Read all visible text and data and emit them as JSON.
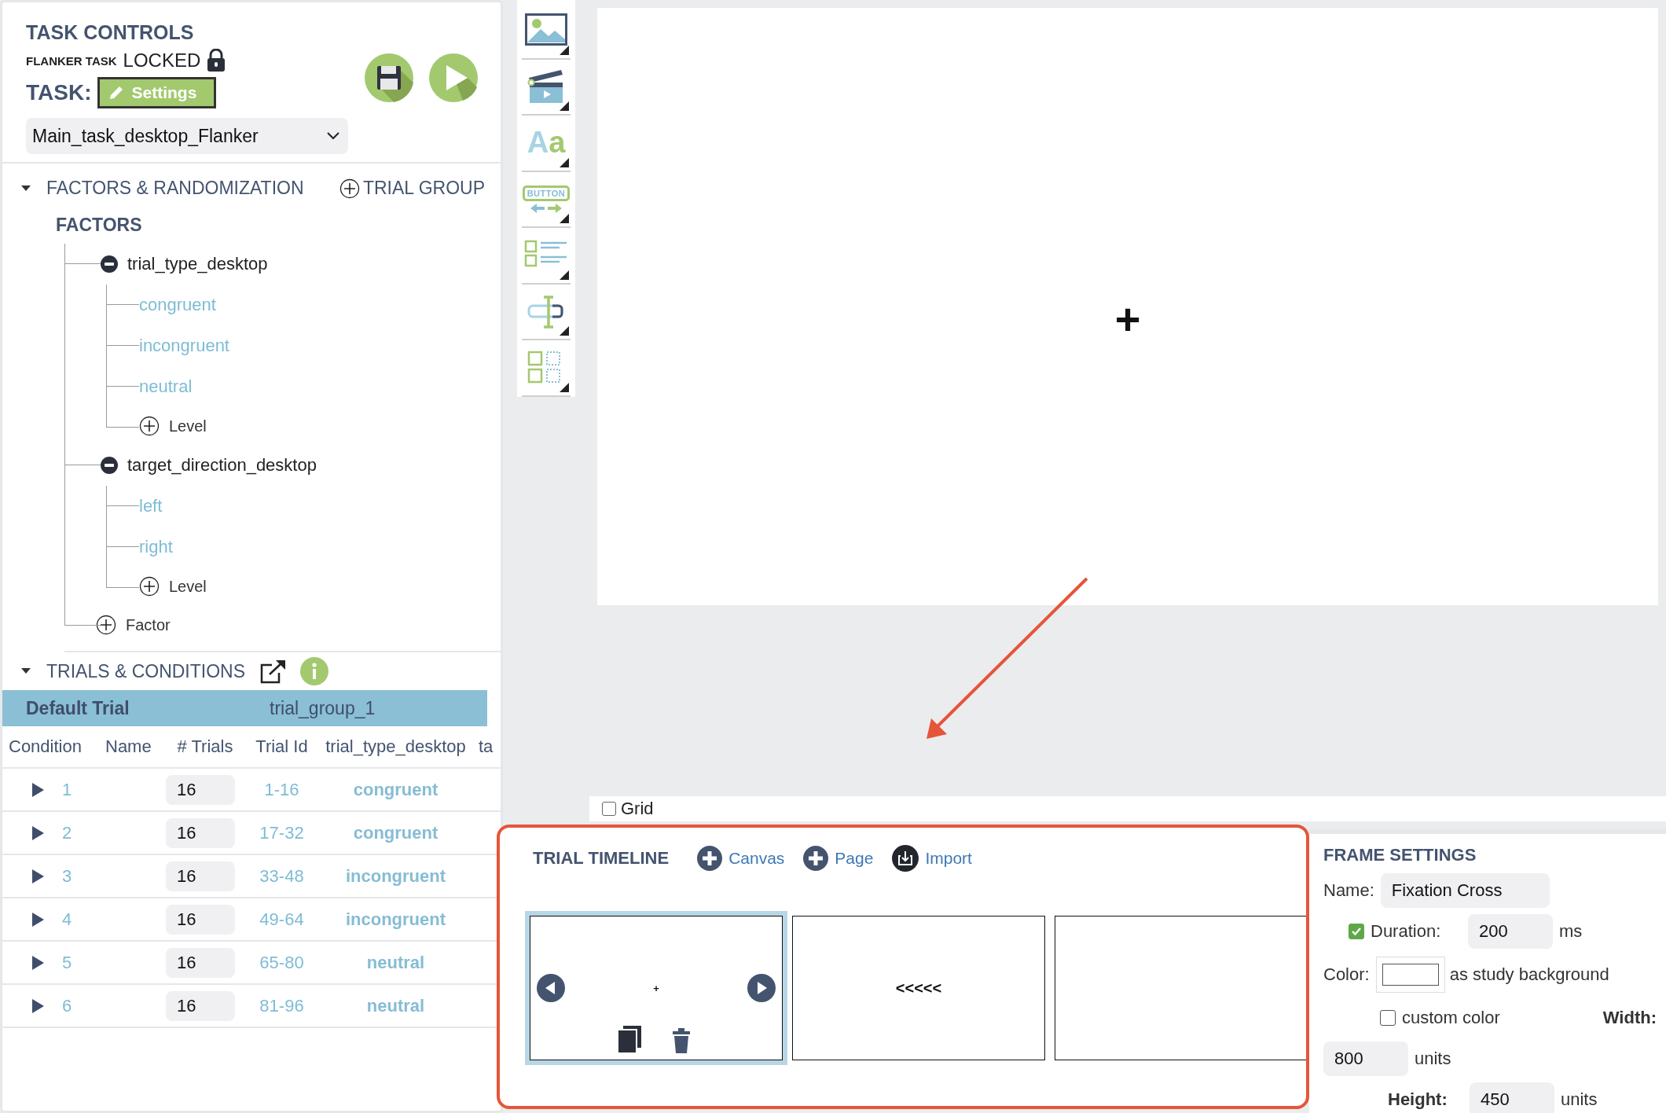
{
  "task_controls": {
    "title": "TASK CONTROLS",
    "task_name": "FLANKER TASK",
    "lock_status": "LOCKED",
    "task_label": "TASK:",
    "settings_button": "Settings",
    "task_select": "Main_task_desktop_Flanker"
  },
  "factors_section": {
    "title": "FACTORS & RANDOMIZATION",
    "expanded": true,
    "add_trial_group": "TRIAL GROUP",
    "factors_heading": "FACTORS",
    "factors": [
      {
        "name": "trial_type_desktop",
        "expanded": true,
        "children": [
          {
            "name": "congruent"
          },
          {
            "name": "incongruent"
          },
          {
            "name": "neutral"
          }
        ],
        "add_level": "Level"
      },
      {
        "name": "target_direction_desktop",
        "expanded": true,
        "children": [
          {
            "name": "left"
          },
          {
            "name": "right"
          }
        ],
        "add_level": "Level"
      }
    ],
    "add_factor": "Factor"
  },
  "trials_section": {
    "title": "TRIALS & CONDITIONS",
    "expanded": true,
    "group_bar": {
      "label": "Default Trial",
      "group": "trial_group_1"
    },
    "columns": [
      "Condition",
      "Name",
      "# Trials",
      "Trial Id",
      "trial_type_desktop",
      "ta"
    ],
    "rows": [
      {
        "condition": "1",
        "trials": "16",
        "trial_id": "1-16",
        "trial_type": "congruent"
      },
      {
        "condition": "2",
        "trials": "16",
        "trial_id": "17-32",
        "trial_type": "congruent"
      },
      {
        "condition": "3",
        "trials": "16",
        "trial_id": "33-48",
        "trial_type": "incongruent"
      },
      {
        "condition": "4",
        "trials": "16",
        "trial_id": "49-64",
        "trial_type": "incongruent"
      },
      {
        "condition": "5",
        "trials": "16",
        "trial_id": "65-80",
        "trial_type": "neutral"
      },
      {
        "condition": "6",
        "trials": "16",
        "trial_id": "81-96",
        "trial_type": "neutral"
      }
    ]
  },
  "tools": [
    {
      "kind": "image"
    },
    {
      "kind": "video"
    },
    {
      "kind": "text",
      "label": "Aa"
    },
    {
      "kind": "button",
      "label": "BUTTON"
    },
    {
      "kind": "checklist"
    },
    {
      "kind": "input"
    },
    {
      "kind": "layout"
    }
  ],
  "stage": {
    "content": "+"
  },
  "grid": {
    "label": "Grid",
    "checked": false
  },
  "timeline": {
    "title": "TRIAL TIMELINE",
    "actions": [
      {
        "kind": "add",
        "label": "Canvas"
      },
      {
        "kind": "add",
        "label": "Page"
      },
      {
        "kind": "import",
        "label": "Import"
      }
    ],
    "frames": [
      {
        "content": "+",
        "selected": true
      },
      {
        "content": "<<<<<",
        "selected": false
      },
      {
        "selected": false
      }
    ]
  },
  "frame_settings": {
    "title": "FRAME SETTINGS",
    "name_label": "Name:",
    "name_value": "Fixation Cross",
    "duration": {
      "checked": true,
      "label": "Duration:",
      "value": "200",
      "unit": "ms"
    },
    "color_label": "Color:",
    "color_note": "as study background",
    "custom_color": {
      "checked": false,
      "label": "custom color"
    },
    "width": {
      "label": "Width:",
      "value": "800",
      "unit": "units"
    },
    "height": {
      "label": "Height:",
      "value": "450",
      "unit": "units"
    }
  }
}
